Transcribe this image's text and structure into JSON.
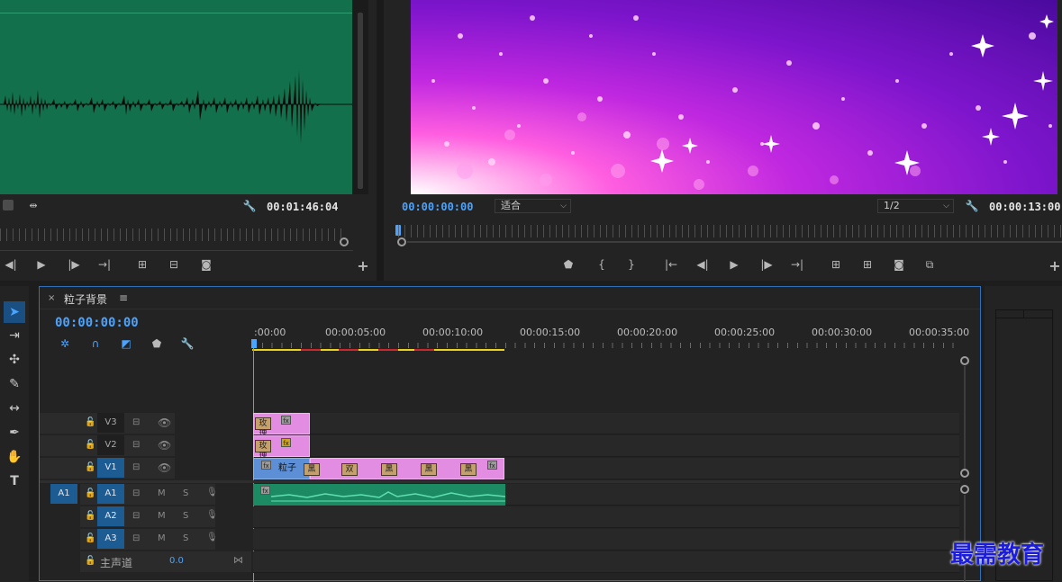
{
  "source_monitor": {
    "timecode": "00:01:46:04"
  },
  "program_monitor": {
    "timecode_current": "00:00:00:00",
    "fit_select": "适合",
    "resolution_select": "1/2",
    "timecode_duration": "00:00:13:00"
  },
  "timeline": {
    "tab_close": "×",
    "sequence_name": "粒子背景",
    "menu_icon": "≡",
    "timecode": "00:00:00:00",
    "ruler_labels": [
      ":00:00",
      "00:00:05:00",
      "00:00:10:00",
      "00:00:15:00",
      "00:00:20:00",
      "00:00:25:00",
      "00:00:30:00",
      "00:00:35:00"
    ],
    "video_tracks": [
      {
        "id": "V3",
        "target": "V3",
        "targeted": false
      },
      {
        "id": "V2",
        "target": "V2",
        "targeted": false
      },
      {
        "id": "V1",
        "target": "V1",
        "targeted": true
      }
    ],
    "audio_tracks": [
      {
        "id": "A1",
        "source": "A1",
        "target": "A1",
        "m": "M",
        "s": "S"
      },
      {
        "id": "A2",
        "source": "",
        "target": "A2",
        "m": "M",
        "s": "S"
      },
      {
        "id": "A3",
        "source": "",
        "target": "A3",
        "m": "M",
        "s": "S"
      }
    ],
    "master": {
      "label": "主声道",
      "value": "0.0"
    },
    "clips": {
      "v3_label": "玫瑰",
      "v2_label": "玫瑰",
      "v1_label": "粒子",
      "v1_trans": [
        "黑",
        "双",
        "黑",
        "黑",
        "黑"
      ],
      "fx_label": "fx"
    }
  },
  "watermark": "最需教育",
  "colors": {
    "accent_blue": "#2d6fb8",
    "timecode_blue": "#4aa3ff",
    "clip_pink": "#e28de2",
    "clip_green": "#1c8a63",
    "wave_bg": "#13704c"
  }
}
